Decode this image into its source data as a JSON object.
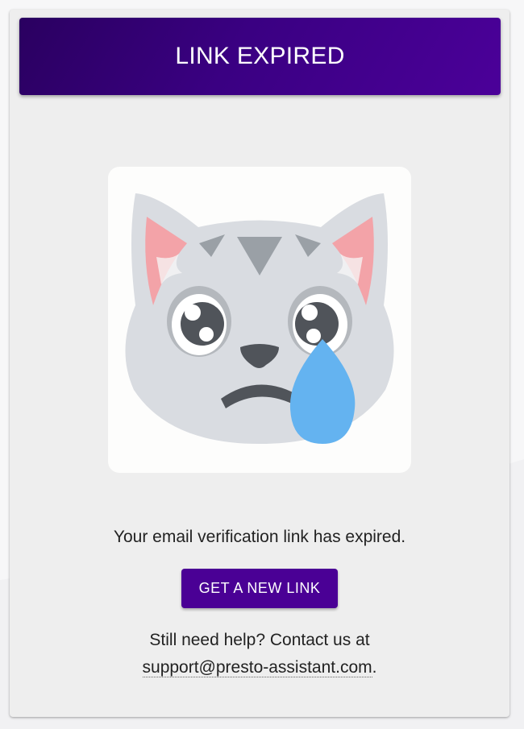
{
  "header": {
    "title": "LINK EXPIRED",
    "gradient_start": "#2a0060",
    "gradient_end": "#4b0099"
  },
  "illustration": {
    "icon": "crying-cat-face-icon"
  },
  "message": "Your email verification link has expired.",
  "action": {
    "label": "GET A NEW LINK",
    "color": "#4a0095"
  },
  "help": {
    "prefix": "Still need help? Contact us at",
    "email": "support@presto-assistant.com",
    "suffix": "."
  }
}
